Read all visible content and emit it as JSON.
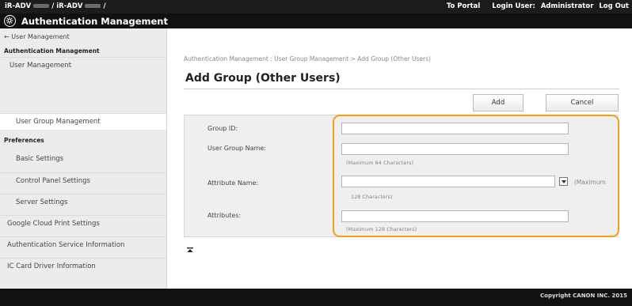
{
  "topbar": {
    "device_prefix": "iR-ADV",
    "device_separator": "/ iR-ADV",
    "device_suffix": "/",
    "to_portal": "To Portal",
    "login_user_label": "Login User:",
    "login_user_value": "Administrator",
    "log_out": "Log Out"
  },
  "app": {
    "title": "Authentication Management",
    "icon": "gear-icon"
  },
  "sidebar": {
    "back_link": "← User Management",
    "section_auth": "Authentication Management",
    "item_user_mgmt": "User Management",
    "item_user_group_mgmt": "User Group Management",
    "section_prefs": "Preferences",
    "item_basic": "Basic Settings",
    "item_control_panel": "Control Panel Settings",
    "item_server": "Server Settings",
    "item_google": "Google Cloud Print Settings",
    "item_auth_service": "Authentication Service Information",
    "item_ic_card": "IC Card Driver Information"
  },
  "main": {
    "breadcrumb": "Authentication Management : User Group Management > Add Group (Other Users)",
    "page_title": "Add Group (Other Users)",
    "add_button": "Add",
    "cancel_button": "Cancel"
  },
  "form": {
    "group_id_label": "Group ID:",
    "group_id_value": "",
    "user_group_name_label": "User Group Name:",
    "user_group_name_value": "",
    "user_group_name_hint": "(Maximum 64 Characters)",
    "attribute_name_label": "Attribute Name:",
    "attribute_name_value": "",
    "attribute_name_hint_a": "(Maximum",
    "attribute_name_hint_b": "128 Characters)",
    "attributes_label": "Attributes:",
    "attributes_value": "",
    "attributes_hint": "(Maximum 128 Characters)"
  },
  "footer": {
    "copyright": "Copyright CANON INC. 2015"
  },
  "colors": {
    "highlight": "#f0a020",
    "header": "#111111",
    "sidebar": "#ececec"
  }
}
